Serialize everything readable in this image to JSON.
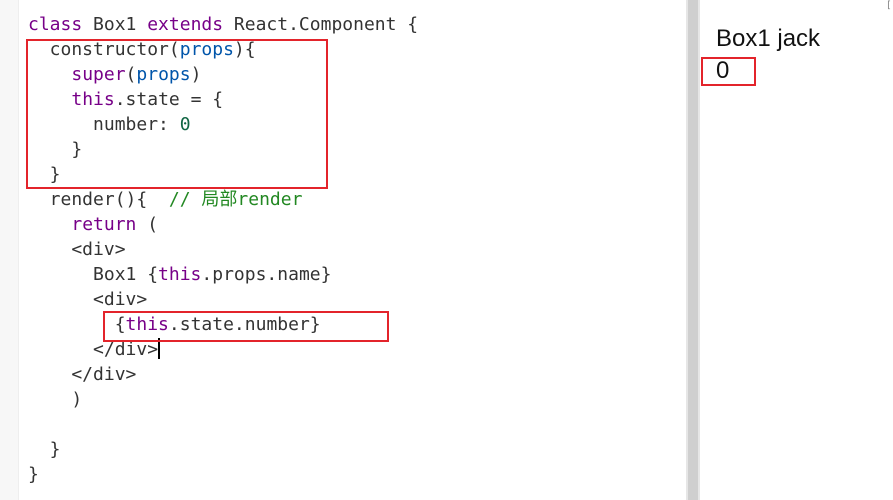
{
  "editor": {
    "lines": [
      [
        {
          "t": "class",
          "c": "kw"
        },
        {
          "t": " Box1 ",
          "c": "plain"
        },
        {
          "t": "extends",
          "c": "kw"
        },
        {
          "t": " React.Component {",
          "c": "plain"
        }
      ],
      [
        {
          "t": "  constructor",
          "c": "plain"
        },
        {
          "t": "(",
          "c": "plain"
        },
        {
          "t": "props",
          "c": "def"
        },
        {
          "t": "){",
          "c": "plain"
        }
      ],
      [
        {
          "t": "    ",
          "c": "plain"
        },
        {
          "t": "super",
          "c": "kw"
        },
        {
          "t": "(",
          "c": "plain"
        },
        {
          "t": "props",
          "c": "def"
        },
        {
          "t": ")",
          "c": "plain"
        }
      ],
      [
        {
          "t": "    ",
          "c": "plain"
        },
        {
          "t": "this",
          "c": "kw"
        },
        {
          "t": ".state = {",
          "c": "plain"
        }
      ],
      [
        {
          "t": "      number: ",
          "c": "plain"
        },
        {
          "t": "0",
          "c": "num"
        }
      ],
      [
        {
          "t": "    }",
          "c": "plain"
        }
      ],
      [
        {
          "t": "  }",
          "c": "plain"
        }
      ],
      [
        {
          "t": "  render(){  ",
          "c": "plain"
        },
        {
          "t": "// 局部render",
          "c": "comment"
        }
      ],
      [
        {
          "t": "    ",
          "c": "plain"
        },
        {
          "t": "return",
          "c": "kw"
        },
        {
          "t": " (",
          "c": "plain"
        }
      ],
      [
        {
          "t": "    <div>",
          "c": "plain"
        }
      ],
      [
        {
          "t": "      Box1 {",
          "c": "plain"
        },
        {
          "t": "this",
          "c": "kw"
        },
        {
          "t": ".props.name}",
          "c": "plain"
        }
      ],
      [
        {
          "t": "      <div>",
          "c": "plain"
        }
      ],
      [
        {
          "t": "        {",
          "c": "plain"
        },
        {
          "t": "this",
          "c": "kw"
        },
        {
          "t": ".state.number}",
          "c": "plain"
        }
      ],
      [
        {
          "t": "      </div>",
          "c": "plain"
        }
      ],
      [
        {
          "t": "    </div>",
          "c": "plain"
        }
      ],
      [
        {
          "t": "    )",
          "c": "plain"
        }
      ],
      [
        {
          "t": "",
          "c": "plain"
        }
      ],
      [
        {
          "t": "  }",
          "c": "plain"
        }
      ],
      [
        {
          "t": "}",
          "c": "plain"
        }
      ]
    ],
    "active_line": 13,
    "cursor_line": 13
  },
  "preview": {
    "title": "Box1 jack",
    "number": "0",
    "corner": "["
  },
  "colors": {
    "highlight_box": "#e3242b",
    "keyword": "#770088",
    "definition": "#0055aa",
    "number": "#116644",
    "comment": "#228822",
    "active_line": "#e8f2fe"
  }
}
